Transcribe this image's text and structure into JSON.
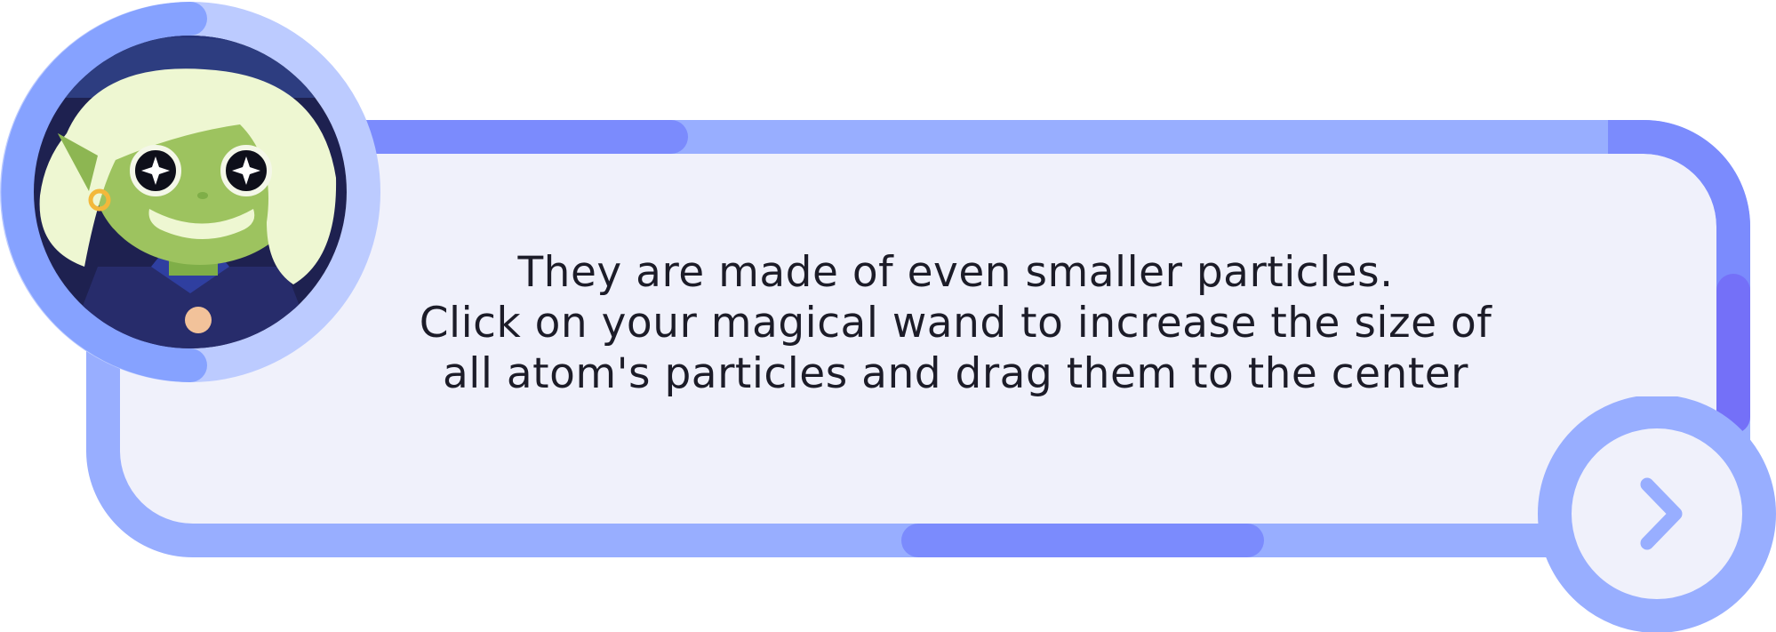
{
  "dialog": {
    "lines": [
      "They are made of even smaller particles.",
      "Click on your magical wand to increase the size of",
      "all atom's particles and drag them to the center"
    ]
  },
  "icons": {
    "next": "chevron-right-icon",
    "avatar": "witch-character-portrait"
  },
  "colors": {
    "frame": "#98aeff",
    "frame_accent": "#7b8bfd",
    "panel_background": "#f0f1fb",
    "avatar_ring": "#98aeff",
    "avatar_background": "#1e2150",
    "skin": "#9dc35f",
    "hair": "#eef7d2",
    "text": "#1c1c28"
  }
}
